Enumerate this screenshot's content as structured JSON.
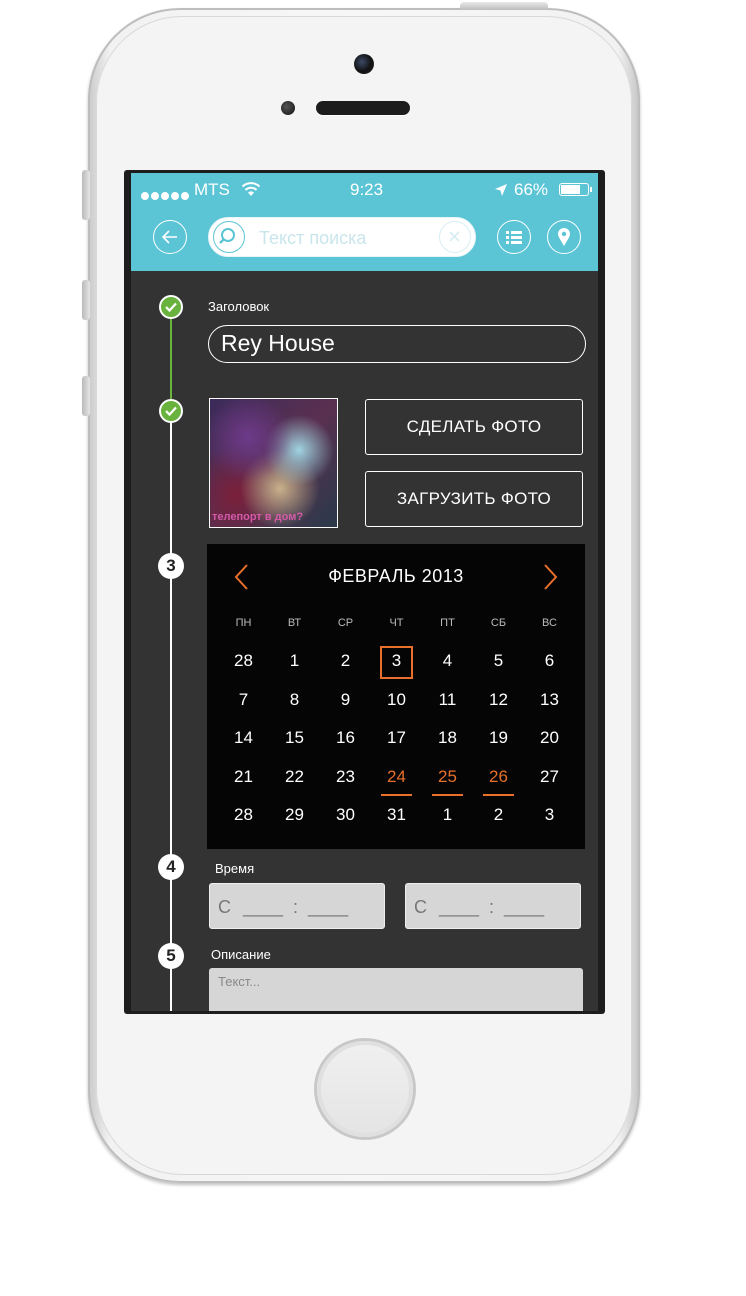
{
  "status_bar": {
    "carrier": "MTS",
    "time": "9:23",
    "battery": "66%",
    "battery_level": 0.66
  },
  "search": {
    "placeholder": "Текст поиска"
  },
  "steps": [
    {
      "state": "done"
    },
    {
      "state": "done"
    },
    {
      "number": "3"
    },
    {
      "number": "4"
    },
    {
      "number": "5"
    }
  ],
  "title_section": {
    "label": "Заголовок",
    "value": "Rey House"
  },
  "photo_section": {
    "photo_caption": "телепорт в дом?",
    "take_photo_label": "СДЕЛАТЬ ФОТО",
    "upload_photo_label": "ЗАГРУЗИТЬ ФОТО"
  },
  "calendar": {
    "month_label": "ФЕВРАЛЬ 2013",
    "prev_icon": "chevron-left-icon",
    "next_icon": "chevron-right-icon",
    "accent_color": "#e8702a",
    "weekdays": [
      "ПН",
      "ВТ",
      "СР",
      "ЧТ",
      "ПТ",
      "СБ",
      "ВС"
    ],
    "weeks": [
      [
        "28",
        "1",
        "2",
        "3",
        "4",
        "5",
        "6"
      ],
      [
        "7",
        "8",
        "9",
        "10",
        "11",
        "12",
        "13"
      ],
      [
        "14",
        "15",
        "16",
        "17",
        "18",
        "19",
        "20"
      ],
      [
        "21",
        "22",
        "23",
        "24",
        "25",
        "26",
        "27"
      ],
      [
        "28",
        "29",
        "30",
        "31",
        "1",
        "2",
        "3"
      ]
    ],
    "today": "3",
    "highlighted": [
      "24",
      "25",
      "26"
    ]
  },
  "time_section": {
    "label": "Время",
    "from_prefix": "С",
    "from_value": "____  :  ____",
    "to_prefix": "С",
    "to_value": "____  :  ____"
  },
  "description_section": {
    "label": "Описание",
    "placeholder": "Текст..."
  },
  "colors": {
    "header": "#5bc5d6",
    "background": "#333333",
    "step_done": "#6ab23e"
  }
}
